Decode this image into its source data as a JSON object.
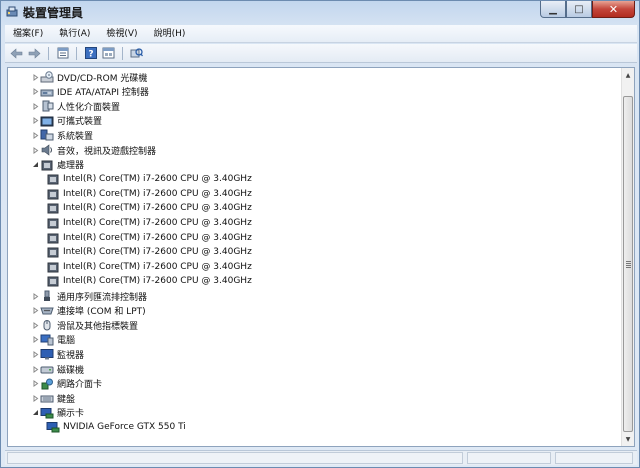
{
  "window": {
    "title": "裝置管理員"
  },
  "menu": {
    "items": [
      "檔案(F)",
      "執行(A)",
      "檢視(V)",
      "說明(H)"
    ]
  },
  "toolbar": {
    "buttons": [
      "back-icon",
      "forward-icon",
      "properties-icon",
      "help-icon",
      "show-hidden-icon",
      "scan-hardware-icon"
    ]
  },
  "tree": {
    "rows": [
      {
        "label": "DVD/CD-ROM 光碟機",
        "icon": "dvd-drive-icon",
        "state": "collapsed",
        "level": 1
      },
      {
        "label": "IDE ATA/ATAPI 控制器",
        "icon": "ide-controller-icon",
        "state": "collapsed",
        "level": 1
      },
      {
        "label": "人性化介面裝置",
        "icon": "hid-icon",
        "state": "collapsed",
        "level": 1
      },
      {
        "label": "可攜式裝置",
        "icon": "portable-device-icon",
        "state": "collapsed",
        "level": 1
      },
      {
        "label": "系統裝置",
        "icon": "system-device-icon",
        "state": "collapsed",
        "level": 1
      },
      {
        "label": "音效，視訊及遊戲控制器",
        "icon": "sound-icon",
        "state": "collapsed",
        "level": 1
      },
      {
        "label": "處理器",
        "icon": "processor-icon",
        "state": "expanded",
        "level": 1
      },
      {
        "label": "Intel(R) Core(TM) i7-2600 CPU @ 3.40GHz",
        "icon": "cpu-icon",
        "state": "leaf",
        "level": 2
      },
      {
        "label": "Intel(R) Core(TM) i7-2600 CPU @ 3.40GHz",
        "icon": "cpu-icon",
        "state": "leaf",
        "level": 2
      },
      {
        "label": "Intel(R) Core(TM) i7-2600 CPU @ 3.40GHz",
        "icon": "cpu-icon",
        "state": "leaf",
        "level": 2
      },
      {
        "label": "Intel(R) Core(TM) i7-2600 CPU @ 3.40GHz",
        "icon": "cpu-icon",
        "state": "leaf",
        "level": 2
      },
      {
        "label": "Intel(R) Core(TM) i7-2600 CPU @ 3.40GHz",
        "icon": "cpu-icon",
        "state": "leaf",
        "level": 2
      },
      {
        "label": "Intel(R) Core(TM) i7-2600 CPU @ 3.40GHz",
        "icon": "cpu-icon",
        "state": "leaf",
        "level": 2
      },
      {
        "label": "Intel(R) Core(TM) i7-2600 CPU @ 3.40GHz",
        "icon": "cpu-icon",
        "state": "leaf",
        "level": 2
      },
      {
        "label": "Intel(R) Core(TM) i7-2600 CPU @ 3.40GHz",
        "icon": "cpu-icon",
        "state": "leaf",
        "level": 2
      },
      {
        "label": "通用序列匯流排控制器",
        "icon": "usb-icon",
        "state": "collapsed",
        "level": 1
      },
      {
        "label": "連接埠 (COM 和 LPT)",
        "icon": "port-icon",
        "state": "collapsed",
        "level": 1
      },
      {
        "label": "滑鼠及其他指標裝置",
        "icon": "mouse-icon",
        "state": "collapsed",
        "level": 1
      },
      {
        "label": "電腦",
        "icon": "computer-icon",
        "state": "collapsed",
        "level": 1
      },
      {
        "label": "監視器",
        "icon": "monitor-icon",
        "state": "collapsed",
        "level": 1
      },
      {
        "label": "磁碟機",
        "icon": "disk-drive-icon",
        "state": "collapsed",
        "level": 1
      },
      {
        "label": "網路介面卡",
        "icon": "network-adapter-icon",
        "state": "collapsed",
        "level": 1
      },
      {
        "label": "鍵盤",
        "icon": "keyboard-icon",
        "state": "collapsed",
        "level": 1
      },
      {
        "label": "顯示卡",
        "icon": "display-adapter-icon",
        "state": "expanded",
        "level": 1
      },
      {
        "label": "NVIDIA GeForce GTX 550 Ti",
        "icon": "gpu-icon",
        "state": "leaf",
        "level": 2
      }
    ]
  }
}
